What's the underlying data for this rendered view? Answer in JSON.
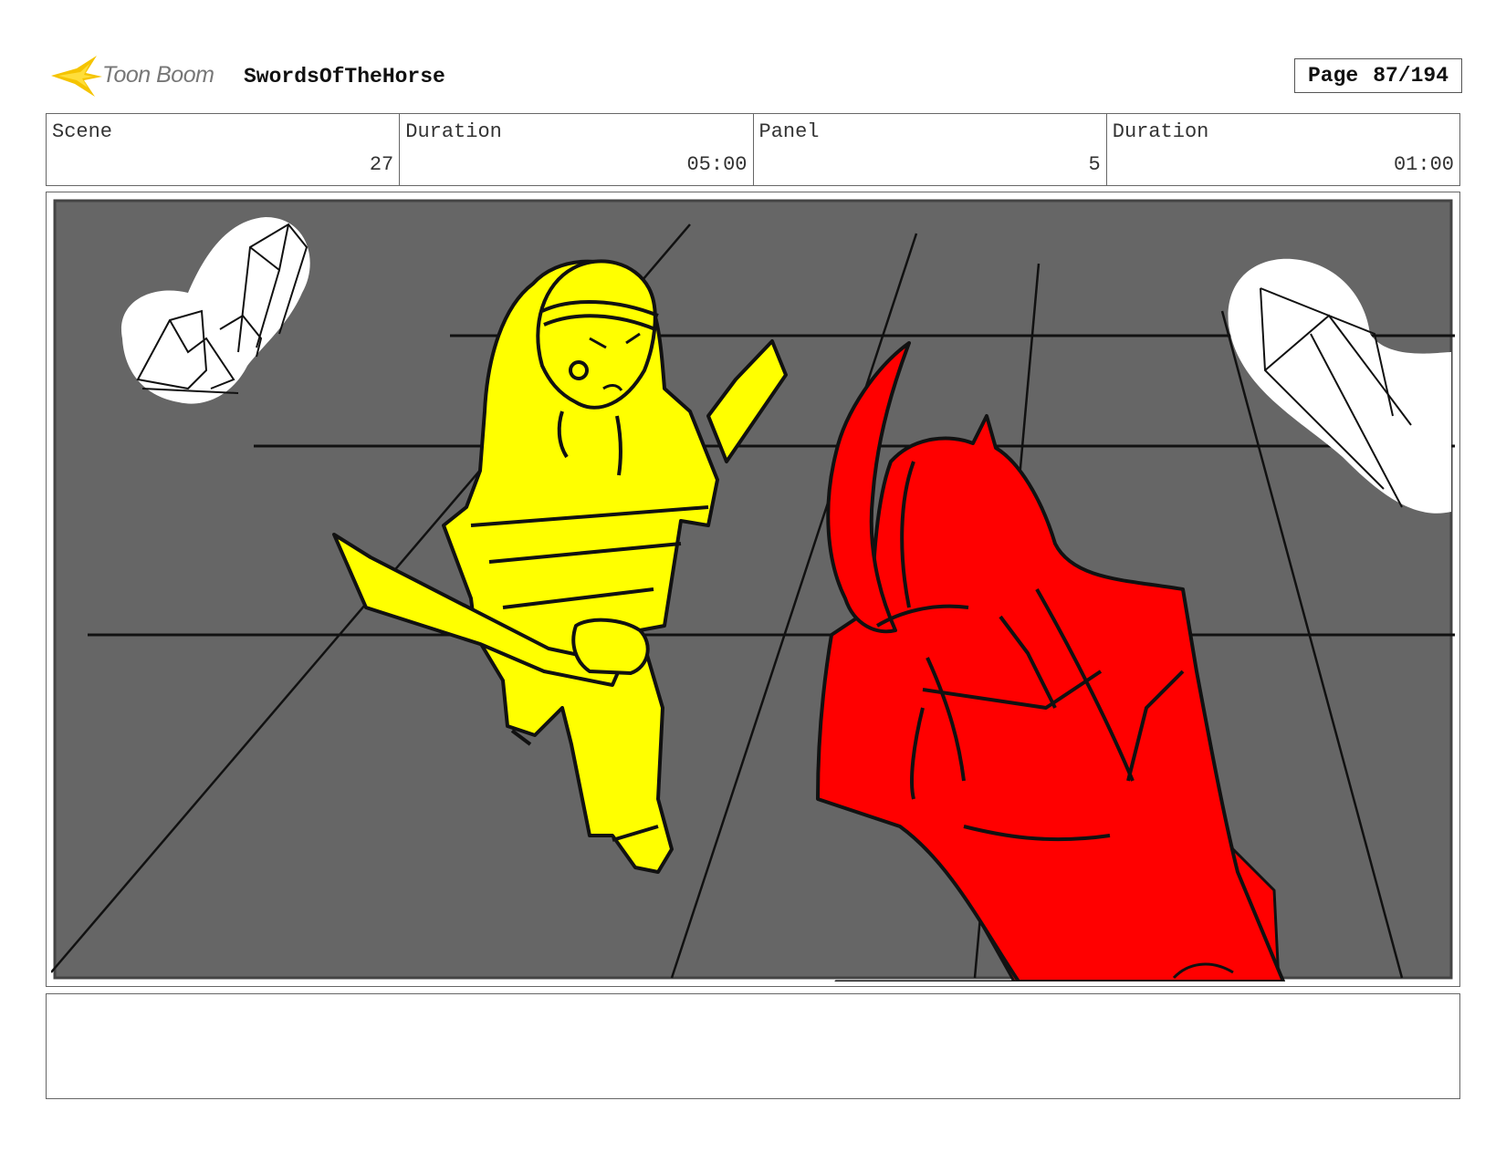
{
  "header": {
    "logo_text": "Toon Boom",
    "project_title": "SwordsOfTheHorse",
    "page_label": "Page",
    "page_value": "87/194"
  },
  "info": {
    "scene_label": "Scene",
    "scene_value": "27",
    "scene_duration_label": "Duration",
    "scene_duration_value": "05:00",
    "panel_label": "Panel",
    "panel_value": "5",
    "panel_duration_label": "Duration",
    "panel_duration_value": "01:00"
  },
  "colors": {
    "background": "#666666",
    "hero": "#ffff00",
    "enemy": "#ff0000",
    "logo_star": "#f5c400"
  },
  "notes": {
    "text": ""
  }
}
